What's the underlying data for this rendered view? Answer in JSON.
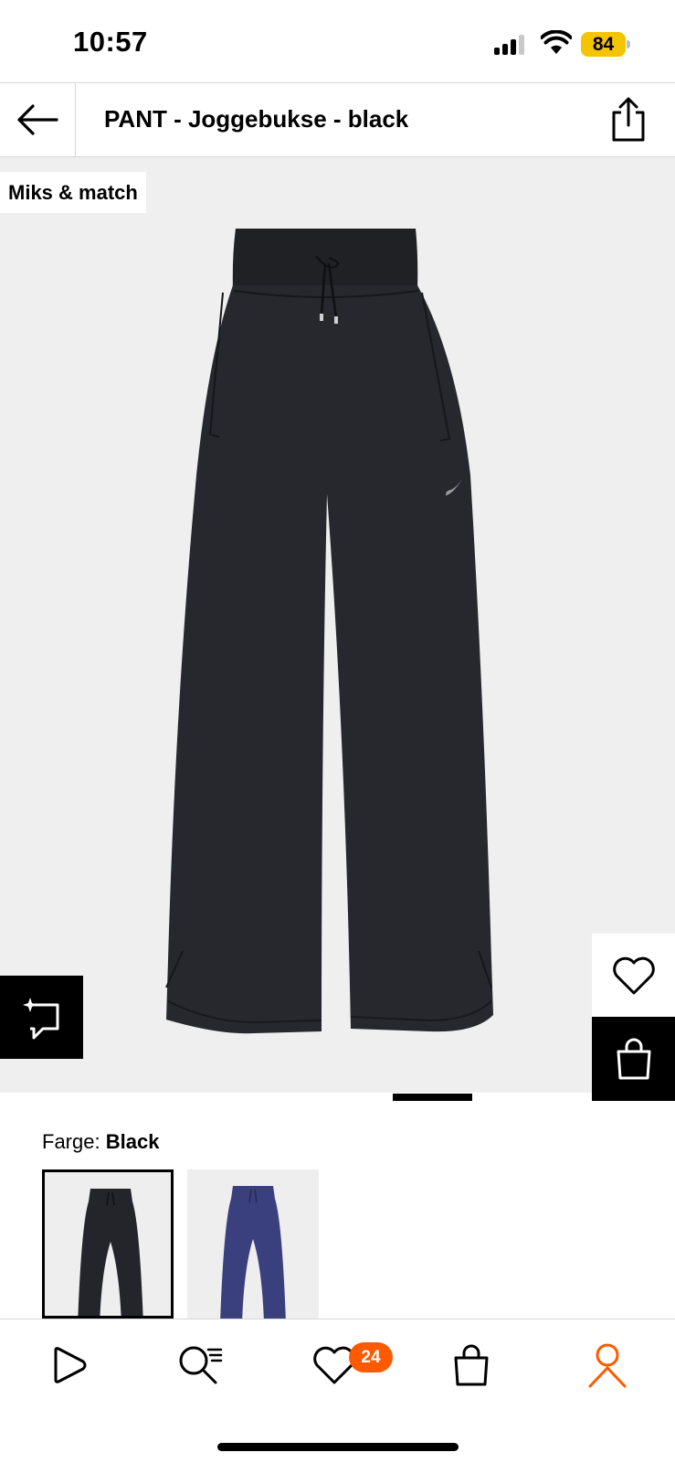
{
  "status_bar": {
    "time": "10:57",
    "battery_level": "84",
    "battery_color": "#f5c400"
  },
  "header": {
    "title": "PANT - Joggebukse - black",
    "back_icon": "arrow-left-icon",
    "share_icon": "share-icon"
  },
  "product_image": {
    "badge_label": "Miks & match",
    "background_color": "#efefef",
    "garment_color": "#23252a",
    "carousel": {
      "current_index": 1,
      "total": 2
    }
  },
  "image_actions": {
    "compare_icon": "compare-icon",
    "wishlist_icon": "heart-icon",
    "add_to_bag_icon": "shopping-bag-icon"
  },
  "color": {
    "label": "Farge:",
    "selected_value": "Black",
    "swatches": [
      {
        "name": "Black",
        "color": "#23252a",
        "selected": true
      },
      {
        "name": "Navy",
        "color": "#3a3f7d",
        "selected": false
      }
    ]
  },
  "bottom_nav": {
    "items": [
      {
        "name": "home",
        "icon": "play-logo-icon"
      },
      {
        "name": "search",
        "icon": "search-icon"
      },
      {
        "name": "wishlist",
        "icon": "heart-icon",
        "badge": "24"
      },
      {
        "name": "bag",
        "icon": "shopping-bag-icon"
      },
      {
        "name": "profile",
        "icon": "user-icon",
        "active": true
      }
    ],
    "accent_color": "#ff5a00"
  }
}
